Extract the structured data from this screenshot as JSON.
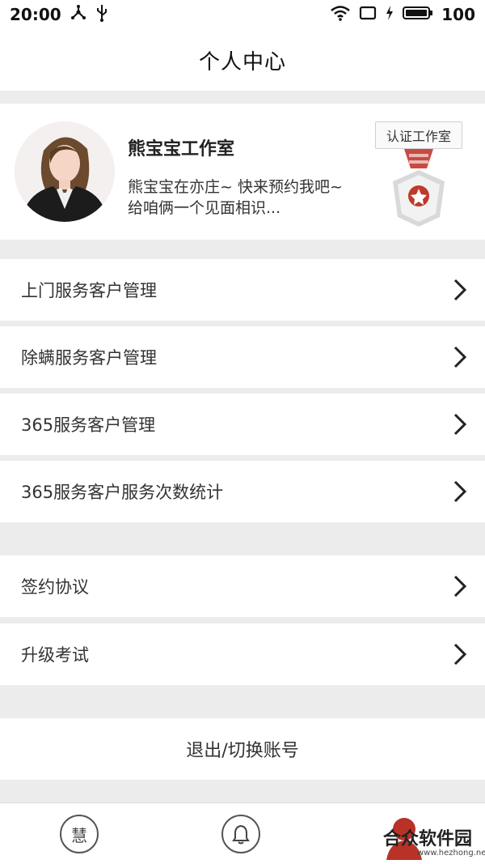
{
  "status_bar": {
    "time": "20:00",
    "battery": "100",
    "icons": [
      "usb-debug-icon",
      "usb-icon",
      "wifi-icon",
      "screen-rotate-icon",
      "charging-icon",
      "battery-icon"
    ]
  },
  "nav": {
    "title": "个人中心"
  },
  "profile": {
    "name": "熊宝宝工作室",
    "description": "熊宝宝在亦庄~ 快来预约我吧~给咱俩一个见面相识...",
    "badge_label": "认证工作室"
  },
  "menu": {
    "items": [
      {
        "label": "上门服务客户管理"
      },
      {
        "label": "除螨服务客户管理"
      },
      {
        "label": "365服务客户管理"
      },
      {
        "label": "365服务客户服务次数统计"
      },
      {
        "label": "签约协议"
      },
      {
        "label": "升级考试"
      }
    ]
  },
  "logout": {
    "label": "退出/切换账号"
  },
  "tabs": {
    "items": [
      {
        "label": "慧",
        "icon": "hui-icon"
      },
      {
        "label": "",
        "icon": "bell-icon"
      },
      {
        "label": "",
        "icon": "profile-icon"
      }
    ]
  },
  "watermark": {
    "main": "合众软件园",
    "sub": "www.hezhong.net"
  },
  "colors": {
    "accent": "#c0392b",
    "background": "#ececec",
    "card": "#ffffff"
  }
}
